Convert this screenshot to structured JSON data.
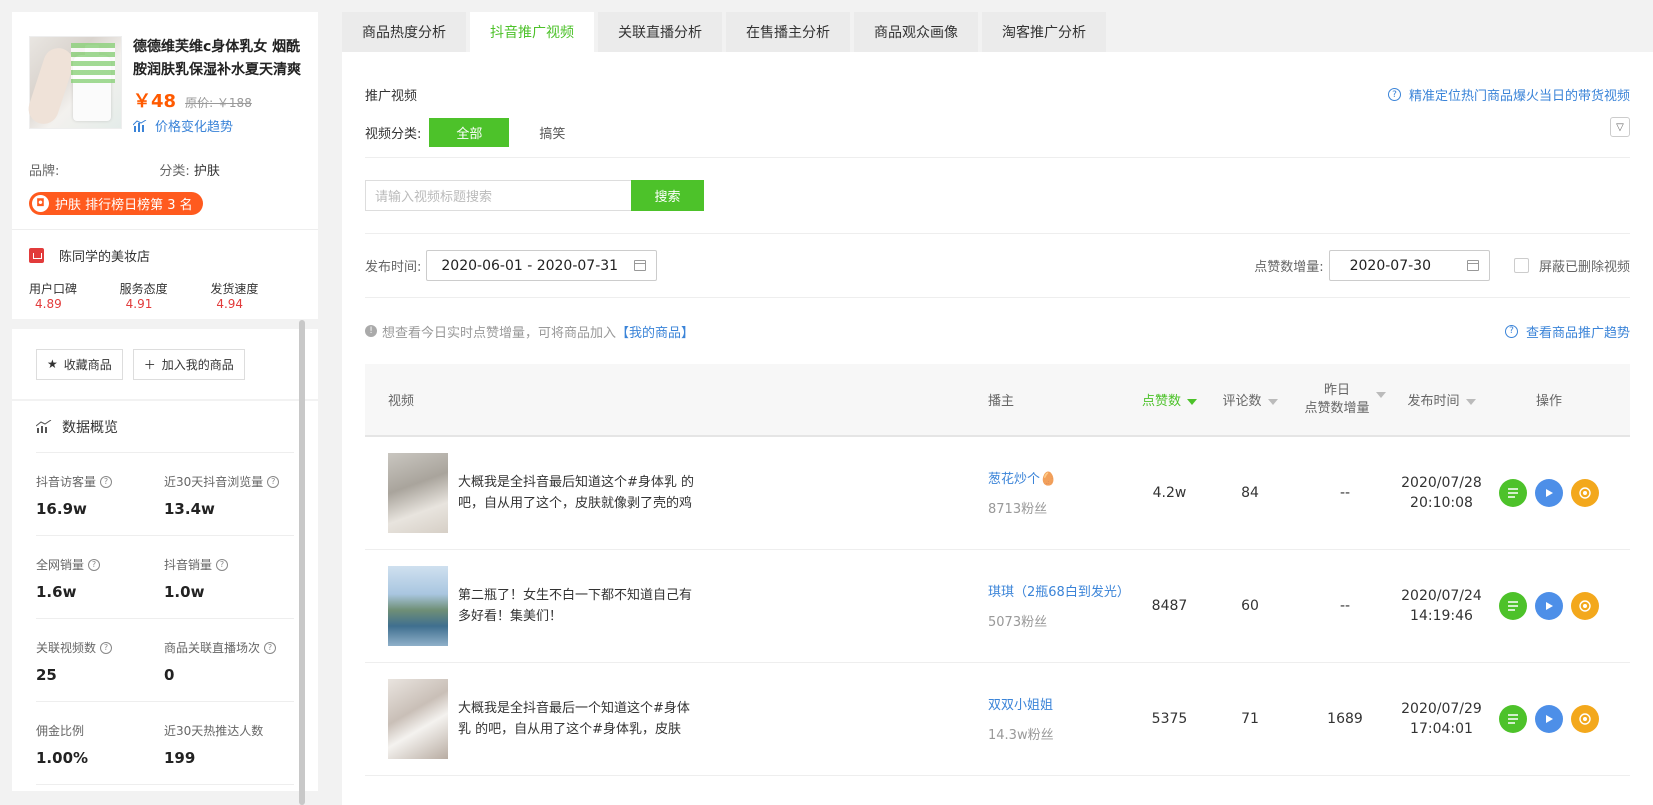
{
  "product": {
    "title": "德德维芙维c身体乳女 烟酰胺润肤乳保湿补水夏天清爽",
    "price": "￥48",
    "original_price": "原价: ￥188",
    "trend_link": "价格变化趋势",
    "brand_label": "品牌:",
    "category_label": "分类:",
    "category_value": "护肤",
    "rank_badge": "护肤 排行榜日榜第 3 名"
  },
  "shop": {
    "name": "陈同学的美妆店",
    "scores": [
      {
        "label": "用户口碑",
        "value": "4.89"
      },
      {
        "label": "服务态度",
        "value": "4.91"
      },
      {
        "label": "发货速度",
        "value": "4.94"
      }
    ]
  },
  "actions": {
    "favorite": "收藏商品",
    "add_mine": "加入我的商品"
  },
  "overview": {
    "title": "数据概览",
    "stats": [
      {
        "label": "抖音访客量",
        "value": "16.9w",
        "help": true
      },
      {
        "label": "近30天抖音浏览量",
        "value": "13.4w",
        "help": true
      },
      {
        "label": "全网销量",
        "value": "1.6w",
        "help": true
      },
      {
        "label": "抖音销量",
        "value": "1.0w",
        "help": true
      },
      {
        "label": "关联视频数",
        "value": "25",
        "help": true
      },
      {
        "label": "商品关联直播场次",
        "value": "0",
        "help": true
      },
      {
        "label": "佣金比例",
        "value": "1.00%",
        "help": false
      },
      {
        "label": "近30天热推达人数",
        "value": "199",
        "help": false
      }
    ]
  },
  "tabs": [
    {
      "label": "商品热度分析",
      "active": false
    },
    {
      "label": "抖音推广视频",
      "active": true
    },
    {
      "label": "关联直播分析",
      "active": false
    },
    {
      "label": "在售播主分析",
      "active": false
    },
    {
      "label": "商品观众画像",
      "active": false
    },
    {
      "label": "淘客推广分析",
      "active": false
    }
  ],
  "panel": {
    "section_title": "推广视频",
    "help_link": "精准定位热门商品爆火当日的带货视频",
    "category_label": "视频分类:",
    "category_all": "全部",
    "category_other": "搞笑",
    "search_placeholder": "请输入视频标题搜索",
    "search_button": "搜索",
    "publish_label": "发布时间:",
    "publish_range": "2020-06-01 - 2020-07-31",
    "likes_inc_label": "点赞数增量:",
    "likes_inc_date": "2020-07-30",
    "hide_deleted": "屏蔽已删除视频",
    "notice_prefix": "想查看今日实时点赞增量，可将商品加入",
    "notice_link": "【我的商品】",
    "trend_link": "查看商品推广趋势"
  },
  "table": {
    "headers": {
      "video": "视频",
      "host": "播主",
      "likes": "点赞数",
      "comments": "评论数",
      "yesterday_1": "昨日",
      "yesterday_2": "点赞数增量",
      "time": "发布时间",
      "op": "操作"
    },
    "rows": [
      {
        "title": "大概我是全抖音最后知道这个#身体乳 的吧，自从用了这个，皮肤就像剥了壳的鸡蛋",
        "host": "葱花炒个🥚",
        "fans": "8713粉丝",
        "likes": "4.2w",
        "comments": "84",
        "yesterday": "--",
        "date": "2020/07/28",
        "time": "20:10:08"
      },
      {
        "title": "第二瓶了！女生不白一下都不知道自己有多好看！集美们！",
        "host": "琪琪（2瓶68白到发光）",
        "fans": "5073粉丝",
        "likes": "8487",
        "comments": "60",
        "yesterday": "--",
        "date": "2020/07/24",
        "time": "14:19:46"
      },
      {
        "title": "大概我是全抖音最后一个知道这个#身体乳 的吧，自从用了这个#身体乳，皮肤",
        "host": "双双小姐姐",
        "fans": "14.3w粉丝",
        "likes": "5375",
        "comments": "71",
        "yesterday": "1689",
        "date": "2020/07/29",
        "time": "17:04:01"
      }
    ]
  },
  "colors": {
    "accent": "#4dc22a",
    "link": "#3b84d8",
    "price": "#ff5a00",
    "score": "#e23b3b"
  }
}
